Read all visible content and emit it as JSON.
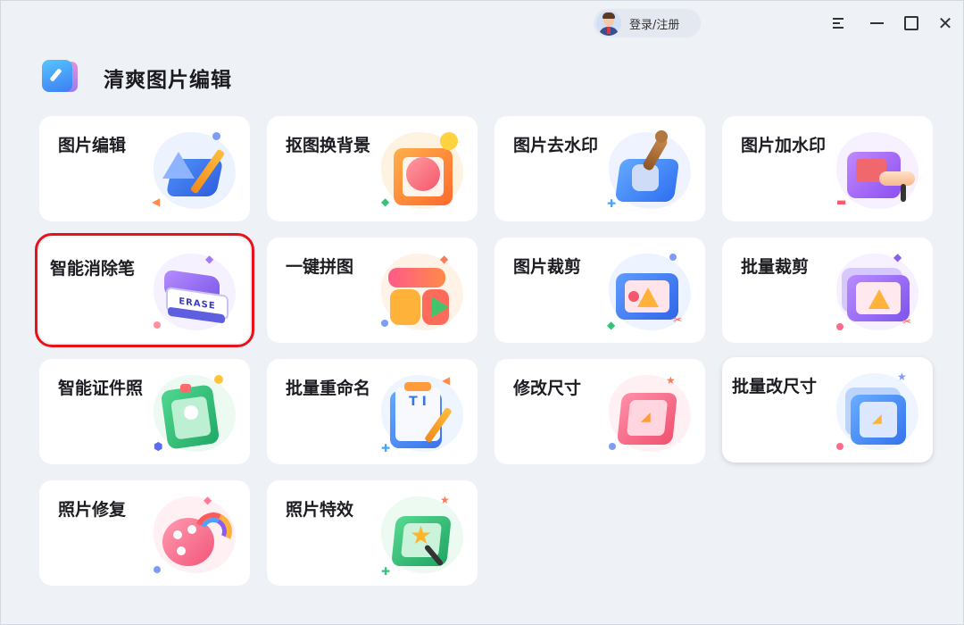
{
  "titlebar": {
    "login_label": "登录/注册",
    "avatar_icon": "user-avatar-icon",
    "buttons": [
      "menu-icon",
      "minimize-icon",
      "maximize-icon",
      "close-icon"
    ]
  },
  "app": {
    "title": "清爽图片编辑",
    "logo_icon": "app-logo-icon"
  },
  "tools": [
    {
      "label": "图片编辑",
      "icon": "ruler-pencil-icon"
    },
    {
      "label": "抠图换背景",
      "icon": "cutout-frame-icon"
    },
    {
      "label": "图片去水印",
      "icon": "stamp-icon"
    },
    {
      "label": "图片加水印",
      "icon": "watermark-roller-icon"
    },
    {
      "label": "智能消除笔",
      "icon": "eraser-icon",
      "erase_text": "ERASE"
    },
    {
      "label": "一键拼图",
      "icon": "collage-icon"
    },
    {
      "label": "图片裁剪",
      "icon": "image-crop-icon"
    },
    {
      "label": "批量裁剪",
      "icon": "batch-crop-icon"
    },
    {
      "label": "智能证件照",
      "icon": "id-photo-icon"
    },
    {
      "label": "批量重命名",
      "icon": "rename-document-icon",
      "doc_text": "T I"
    },
    {
      "label": "修改尺寸",
      "icon": "resize-icon"
    },
    {
      "label": "批量改尺寸",
      "icon": "batch-resize-icon"
    },
    {
      "label": "照片修复",
      "icon": "palette-rainbow-icon"
    },
    {
      "label": "照片特效",
      "icon": "star-wand-icon"
    }
  ],
  "colors": {
    "highlight": "#e8121a",
    "background": "#eef1f6",
    "card": "#ffffff"
  }
}
